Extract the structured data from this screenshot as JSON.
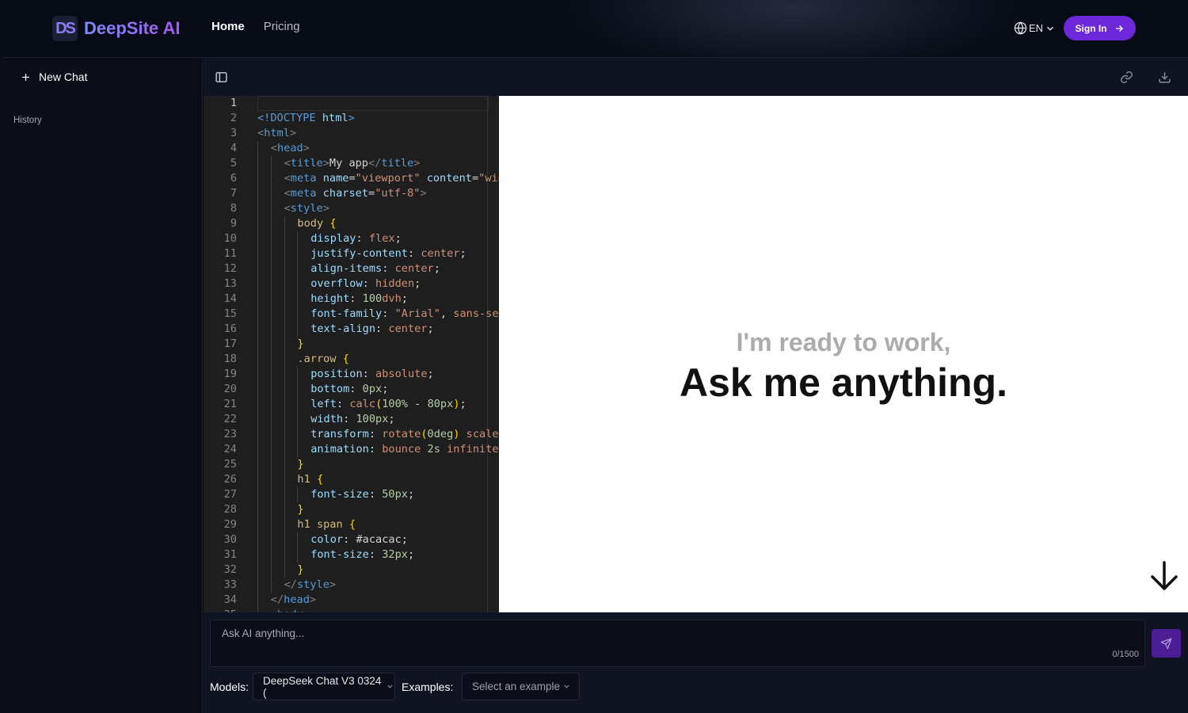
{
  "brand": {
    "name": "DeepSite AI",
    "logo_text": "DS"
  },
  "nav": {
    "home": "Home",
    "pricing": "Pricing",
    "language": "EN",
    "sign_in": "Sign In"
  },
  "sidebar": {
    "new_chat": "New Chat",
    "history": "History"
  },
  "editor": {
    "active_line": 1,
    "lines": [
      [],
      [
        [
          "t-tag",
          "<!DOCTYPE"
        ],
        [
          "t-def",
          " "
        ],
        [
          "t-at",
          "html"
        ],
        [
          "t-tag",
          ">"
        ]
      ],
      [
        [
          "t-br",
          "<"
        ],
        [
          "t-tag",
          "html"
        ],
        [
          "t-br",
          ">"
        ]
      ],
      [
        [
          "t-br",
          "<"
        ],
        [
          "t-tag",
          "head"
        ],
        [
          "t-br",
          ">"
        ]
      ],
      [
        [
          "t-br",
          "<"
        ],
        [
          "t-tag",
          "title"
        ],
        [
          "t-br",
          ">"
        ],
        [
          "t-def",
          "My app"
        ],
        [
          "t-br",
          "</"
        ],
        [
          "t-tag",
          "title"
        ],
        [
          "t-br",
          ">"
        ]
      ],
      [
        [
          "t-br",
          "<"
        ],
        [
          "t-tag",
          "meta"
        ],
        [
          "t-def",
          " "
        ],
        [
          "t-at",
          "name"
        ],
        [
          "t-def",
          "="
        ],
        [
          "t-str",
          "\"viewport\""
        ],
        [
          "t-def",
          " "
        ],
        [
          "t-at",
          "content"
        ],
        [
          "t-def",
          "="
        ],
        [
          "t-str",
          "\"width=device-width\""
        ]
      ],
      [
        [
          "t-br",
          "<"
        ],
        [
          "t-tag",
          "meta"
        ],
        [
          "t-def",
          " "
        ],
        [
          "t-at",
          "charset"
        ],
        [
          "t-def",
          "="
        ],
        [
          "t-str",
          "\"utf-8\""
        ],
        [
          "t-br",
          ">"
        ]
      ],
      [
        [
          "t-br",
          "<"
        ],
        [
          "t-tag",
          "style"
        ],
        [
          "t-br",
          ">"
        ]
      ],
      [
        [
          "t-sel",
          "body"
        ],
        [
          "t-def",
          " "
        ],
        [
          "t-cur",
          "{"
        ]
      ],
      [
        [
          "t-prop",
          "display"
        ],
        [
          "t-def",
          ": "
        ],
        [
          "t-val",
          "flex"
        ],
        [
          "t-def",
          ";"
        ]
      ],
      [
        [
          "t-prop",
          "justify-content"
        ],
        [
          "t-def",
          ": "
        ],
        [
          "t-val",
          "center"
        ],
        [
          "t-def",
          ";"
        ]
      ],
      [
        [
          "t-prop",
          "align-items"
        ],
        [
          "t-def",
          ": "
        ],
        [
          "t-val",
          "center"
        ],
        [
          "t-def",
          ";"
        ]
      ],
      [
        [
          "t-prop",
          "overflow"
        ],
        [
          "t-def",
          ": "
        ],
        [
          "t-val",
          "hidden"
        ],
        [
          "t-def",
          ";"
        ]
      ],
      [
        [
          "t-prop",
          "height"
        ],
        [
          "t-def",
          ": "
        ],
        [
          "t-num",
          "100"
        ],
        [
          "t-val",
          "dvh"
        ],
        [
          "t-def",
          ";"
        ]
      ],
      [
        [
          "t-prop",
          "font-family"
        ],
        [
          "t-def",
          ": "
        ],
        [
          "t-str",
          "\"Arial\""
        ],
        [
          "t-def",
          ", "
        ],
        [
          "t-val",
          "sans-serif"
        ],
        [
          "t-def",
          ";"
        ]
      ],
      [
        [
          "t-prop",
          "text-align"
        ],
        [
          "t-def",
          ": "
        ],
        [
          "t-val",
          "center"
        ],
        [
          "t-def",
          ";"
        ]
      ],
      [
        [
          "t-cur",
          "}"
        ]
      ],
      [
        [
          "t-sel",
          ".arrow"
        ],
        [
          "t-def",
          " "
        ],
        [
          "t-cur",
          "{"
        ]
      ],
      [
        [
          "t-prop",
          "position"
        ],
        [
          "t-def",
          ": "
        ],
        [
          "t-val",
          "absolute"
        ],
        [
          "t-def",
          ";"
        ]
      ],
      [
        [
          "t-prop",
          "bottom"
        ],
        [
          "t-def",
          ": "
        ],
        [
          "t-num",
          "0px"
        ],
        [
          "t-def",
          ";"
        ]
      ],
      [
        [
          "t-prop",
          "left"
        ],
        [
          "t-def",
          ": "
        ],
        [
          "t-val",
          "calc"
        ],
        [
          "t-cur",
          "("
        ],
        [
          "t-num",
          "100%"
        ],
        [
          "t-def",
          " - "
        ],
        [
          "t-num",
          "80px"
        ],
        [
          "t-cur",
          ")"
        ],
        [
          "t-def",
          ";"
        ]
      ],
      [
        [
          "t-prop",
          "width"
        ],
        [
          "t-def",
          ": "
        ],
        [
          "t-num",
          "100px"
        ],
        [
          "t-def",
          ";"
        ]
      ],
      [
        [
          "t-prop",
          "transform"
        ],
        [
          "t-def",
          ": "
        ],
        [
          "t-val",
          "rotate"
        ],
        [
          "t-cur",
          "("
        ],
        [
          "t-num",
          "0deg"
        ],
        [
          "t-cur",
          ")"
        ],
        [
          "t-def",
          " "
        ],
        [
          "t-val",
          "scale"
        ],
        [
          "t-cur",
          "("
        ],
        [
          "t-num",
          "-1"
        ],
        [
          "t-cur",
          ")"
        ]
      ],
      [
        [
          "t-prop",
          "animation"
        ],
        [
          "t-def",
          ": "
        ],
        [
          "t-val",
          "bounce"
        ],
        [
          "t-def",
          " "
        ],
        [
          "t-num",
          "2s"
        ],
        [
          "t-def",
          " "
        ],
        [
          "t-val",
          "infinite"
        ],
        [
          "t-def",
          ";"
        ]
      ],
      [
        [
          "t-cur",
          "}"
        ]
      ],
      [
        [
          "t-sel",
          "h1"
        ],
        [
          "t-def",
          " "
        ],
        [
          "t-cur",
          "{"
        ]
      ],
      [
        [
          "t-prop",
          "font-size"
        ],
        [
          "t-def",
          ": "
        ],
        [
          "t-num",
          "50px"
        ],
        [
          "t-def",
          ";"
        ]
      ],
      [
        [
          "t-cur",
          "}"
        ]
      ],
      [
        [
          "t-sel",
          "h1 span"
        ],
        [
          "t-def",
          " "
        ],
        [
          "t-cur",
          "{"
        ]
      ],
      [
        [
          "t-prop",
          "color"
        ],
        [
          "t-def",
          ": "
        ],
        [
          "t-def",
          "#acacac"
        ],
        [
          "t-def",
          ";"
        ]
      ],
      [
        [
          "t-prop",
          "font-size"
        ],
        [
          "t-def",
          ": "
        ],
        [
          "t-num",
          "32px"
        ],
        [
          "t-def",
          ";"
        ]
      ],
      [
        [
          "t-cur",
          "}"
        ]
      ],
      [
        [
          "t-br",
          "</"
        ],
        [
          "t-tag",
          "style"
        ],
        [
          "t-br",
          ">"
        ]
      ],
      [
        [
          "t-br",
          "</"
        ],
        [
          "t-tag",
          "head"
        ],
        [
          "t-br",
          ">"
        ]
      ],
      [
        [
          "t-br",
          "<"
        ],
        [
          "t-tag",
          "body"
        ],
        [
          "t-br",
          ">"
        ]
      ]
    ],
    "indents": [
      0,
      0,
      0,
      1,
      2,
      2,
      2,
      2,
      3,
      4,
      4,
      4,
      4,
      4,
      4,
      4,
      3,
      3,
      4,
      4,
      4,
      4,
      4,
      4,
      3,
      3,
      4,
      3,
      3,
      4,
      4,
      3,
      2,
      1,
      1
    ]
  },
  "preview": {
    "subtitle": "I'm ready to work,",
    "headline": "Ask me anything."
  },
  "prompt": {
    "placeholder": "Ask AI anything...",
    "value": "",
    "char_count": "0/1500"
  },
  "footer": {
    "models_label": "Models:",
    "model_selected": "DeepSeek Chat V3 0324 (",
    "examples_label": "Examples:",
    "examples_placeholder": "Select an example"
  },
  "colors": {
    "accent": "#6d28d9",
    "send": "#4c1d95",
    "brand_gradient_start": "#7c8cf8",
    "brand_gradient_end": "#a855f7"
  },
  "icons": [
    "ds-logo-icon",
    "globe-icon",
    "chevron-down-icon",
    "arrow-right-icon",
    "plus-icon",
    "sidebar-toggle-icon",
    "link-icon",
    "download-icon",
    "arrow-down-icon",
    "send-icon"
  ]
}
